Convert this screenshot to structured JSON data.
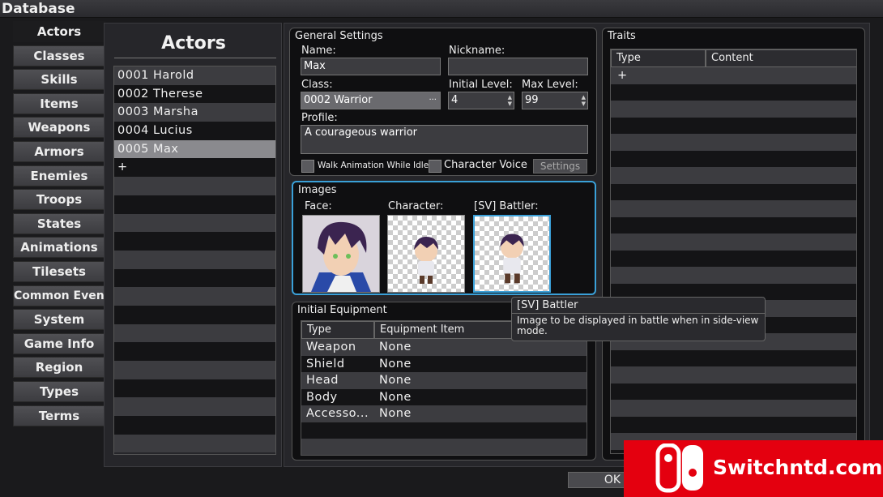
{
  "window": {
    "title": "Database"
  },
  "nav": {
    "items": [
      "Actors",
      "Classes",
      "Skills",
      "Items",
      "Weapons",
      "Armors",
      "Enemies",
      "Troops",
      "States",
      "Animations",
      "Tilesets",
      "Common Events",
      "System",
      "Game Info",
      "Region",
      "Types",
      "Terms"
    ],
    "selected": "Actors"
  },
  "actors": {
    "title": "Actors",
    "items": [
      "0001 Harold",
      "0002 Therese",
      "0003 Marsha",
      "0004 Lucius",
      "0005 Max",
      "+"
    ],
    "selected": "0005 Max"
  },
  "general": {
    "title": "General Settings",
    "name_label": "Name:",
    "name_value": "Max",
    "nickname_label": "Nickname:",
    "nickname_value": "",
    "class_label": "Class:",
    "class_value": "0002 Warrior",
    "class_button": "···",
    "initial_level_label": "Initial Level:",
    "initial_level_value": "4",
    "max_level_label": "Max Level:",
    "max_level_value": "99",
    "profile_label": "Profile:",
    "profile_value": "A courageous warrior",
    "walk_anim_label": "Walk Animation While Idle",
    "char_voice_label": "Character Voice",
    "settings_button": "Settings"
  },
  "images": {
    "title": "Images",
    "face_label": "Face:",
    "character_label": "Character:",
    "battler_label": "[SV] Battler:"
  },
  "equipment": {
    "title": "Initial Equipment",
    "col_type": "Type",
    "col_item": "Equipment Item",
    "rows": [
      {
        "type": "Weapon",
        "item": "None"
      },
      {
        "type": "Shield",
        "item": "None"
      },
      {
        "type": "Head",
        "item": "None"
      },
      {
        "type": "Body",
        "item": "None"
      },
      {
        "type": "Accesso...",
        "item": "None"
      }
    ]
  },
  "traits": {
    "title": "Traits",
    "col_type": "Type",
    "col_content": "Content",
    "add": "+"
  },
  "tooltip": {
    "title": "[SV] Battler",
    "text": "Image to be displayed in battle when in side-view mode."
  },
  "footer": {
    "ok": "OK"
  },
  "watermark": {
    "text": "Switchntd.com"
  },
  "colors": {
    "accent": "#3aa0d8",
    "watermark": "#e4000f"
  }
}
